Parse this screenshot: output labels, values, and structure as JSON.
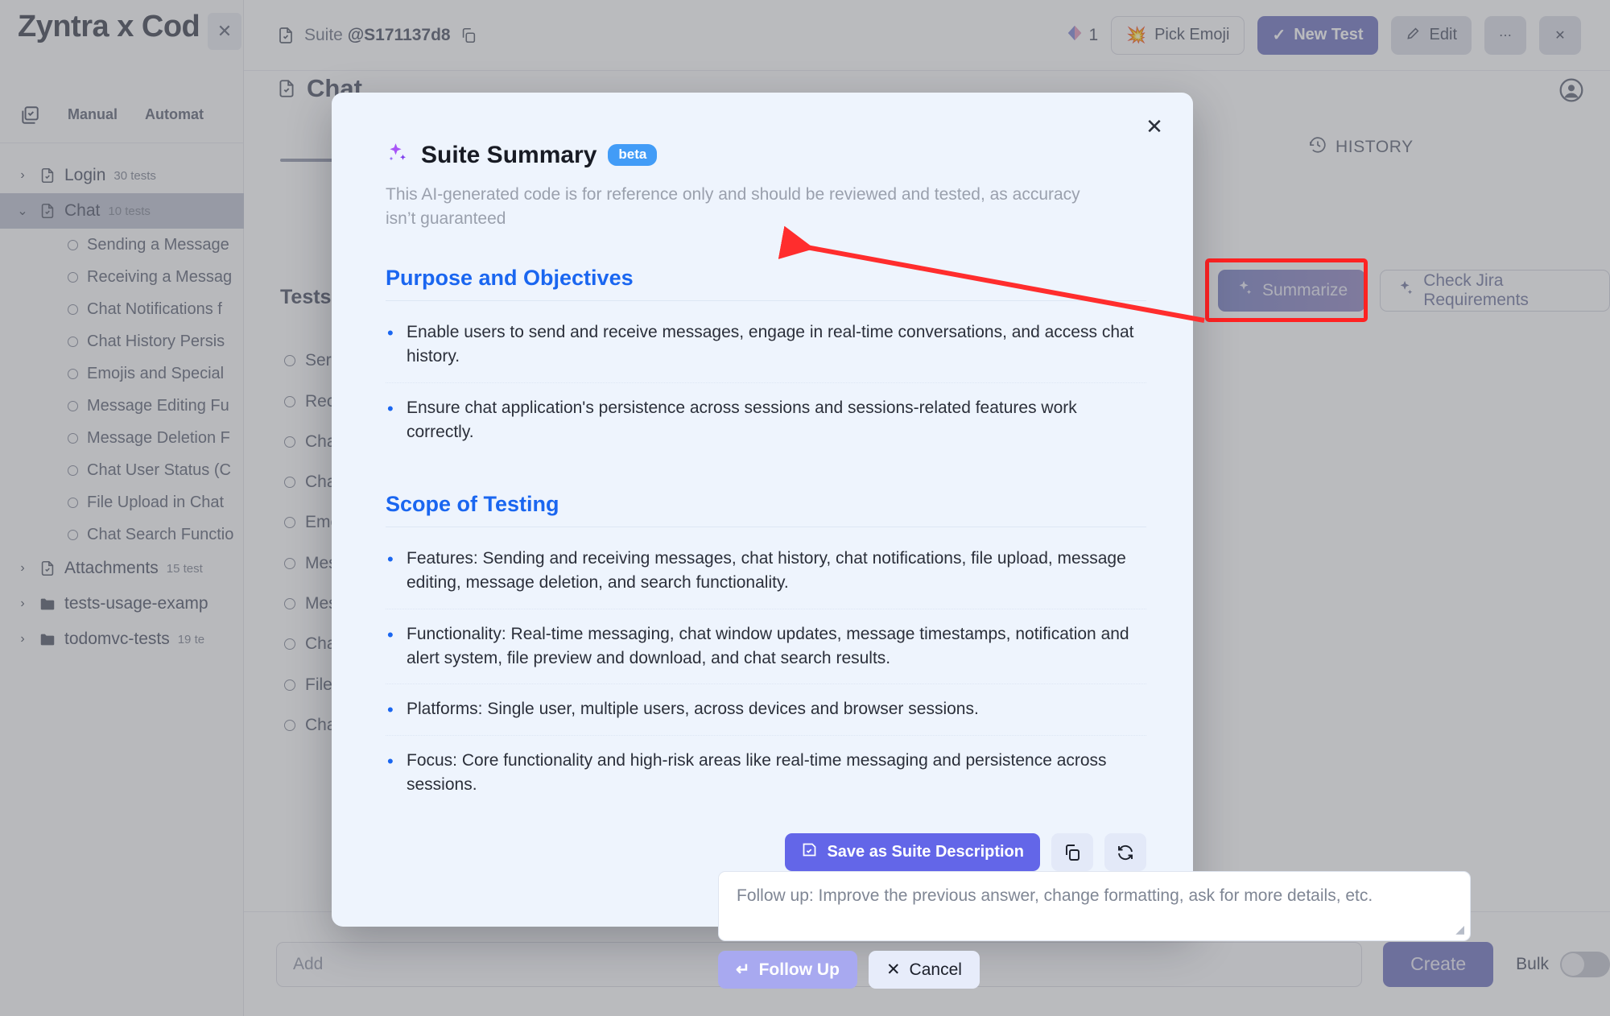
{
  "sidebar": {
    "title": "Zyntra x Cod",
    "close_icon": "close-icon",
    "tabs": [
      {
        "label": "",
        "icon": "test-suite-icon"
      },
      {
        "label": "Manual",
        "icon": ""
      },
      {
        "label": "Automat",
        "icon": ""
      }
    ],
    "tree": [
      {
        "label": "Login",
        "count": "30 tests",
        "twisty": "chevron-right",
        "icon": "file-check-icon",
        "selected": false
      },
      {
        "label": "Chat",
        "count": "10 tests",
        "twisty": "chevron-down",
        "icon": "file-check-icon",
        "selected": true
      },
      {
        "label": "Attachments",
        "count": "15 test",
        "twisty": "chevron-right",
        "icon": "file-check-icon",
        "selected": false
      },
      {
        "label": "tests-usage-examp",
        "count": "",
        "twisty": "chevron-right",
        "icon": "folder-icon",
        "selected": false
      },
      {
        "label": "todomvc-tests",
        "count": "19 te",
        "twisty": "chevron-right",
        "icon": "folder-icon",
        "selected": false
      }
    ],
    "children": [
      "Sending a Message",
      "Receiving a Messag",
      "Chat Notifications f",
      "Chat History Persis",
      "Emojis and Special",
      "Message Editing Fu",
      "Message Deletion F",
      "Chat User Status (C",
      "File Upload in Chat",
      "Chat Search Functio"
    ]
  },
  "topbar": {
    "suite_icon": "file-check-icon",
    "suite_prefix": "Suite ",
    "suite_id": "@S171137d8",
    "copy_icon": "copy-icon",
    "diamond_icon": "diamond-icon",
    "diamond_count": "1",
    "pick_emoji": "Pick Emoji",
    "pick_emoji_icon": "sparkle-emoji-icon",
    "new_test": "New Test",
    "new_test_icon": "check-icon",
    "edit": "Edit",
    "edit_icon": "pencil-icon",
    "more_icon": "ellipsis-icon",
    "close_icon": "close-icon"
  },
  "page": {
    "title": "Chat",
    "title_icon": "file-check-icon",
    "avatar_icon": "account-circle-icon",
    "history_label": "HISTORY",
    "history_icon": "history-icon",
    "tests_label": "Tests ",
    "summarize": "Summarize",
    "summarize_icon": "sparkles-icon",
    "check_jira": "Check Jira Requirements",
    "check_jira_icon": "sparkles-icon",
    "bg_rows": [
      "Ser",
      "Rec",
      "Cha",
      "Cha",
      "Emo",
      "Mes",
      "Mes",
      "Cha",
      "File",
      "Cha"
    ]
  },
  "bottombar": {
    "add_placeholder": "Add ",
    "create": "Create",
    "bulk": "Bulk"
  },
  "modal": {
    "close_icon": "close-icon",
    "sparkles_icon": "sparkles-icon",
    "title": "Suite Summary",
    "badge": "beta",
    "subtitle": "This AI-generated code is for reference only and should be reviewed and tested, as accuracy isn’t guaranteed",
    "sections": [
      {
        "heading": "Purpose and Objectives",
        "bullets": [
          "Enable users to send and receive messages, engage in real-time conversations, and access chat history.",
          "Ensure chat application's persistence across sessions and sessions-related features work correctly."
        ]
      },
      {
        "heading": "Scope of Testing",
        "bullets": [
          "Features: Sending and receiving messages, chat history, chat notifications, file upload, message editing, message deletion, and search functionality.",
          "Functionality: Real-time messaging, chat window updates, message timestamps, notification and alert system, file preview and download, and chat search results.",
          "Platforms: Single user, multiple users, across devices and browser sessions.",
          "Focus: Core functionality and high-risk areas like real-time messaging and persistence across sessions."
        ]
      }
    ],
    "save_label": "Save as Suite Description",
    "save_icon": "save-icon",
    "copy_icon": "copy-icon",
    "refresh_icon": "refresh-icon",
    "followup_placeholder": "Follow up: Improve the previous answer, change formatting, ask for more details, etc.",
    "follow_up": "Follow Up",
    "follow_up_icon": "enter-key-icon",
    "cancel": "Cancel",
    "cancel_icon": "close-icon"
  },
  "annotation": {
    "arrow_color": "#ff2d2d",
    "highlight_color": "#ff2222"
  }
}
